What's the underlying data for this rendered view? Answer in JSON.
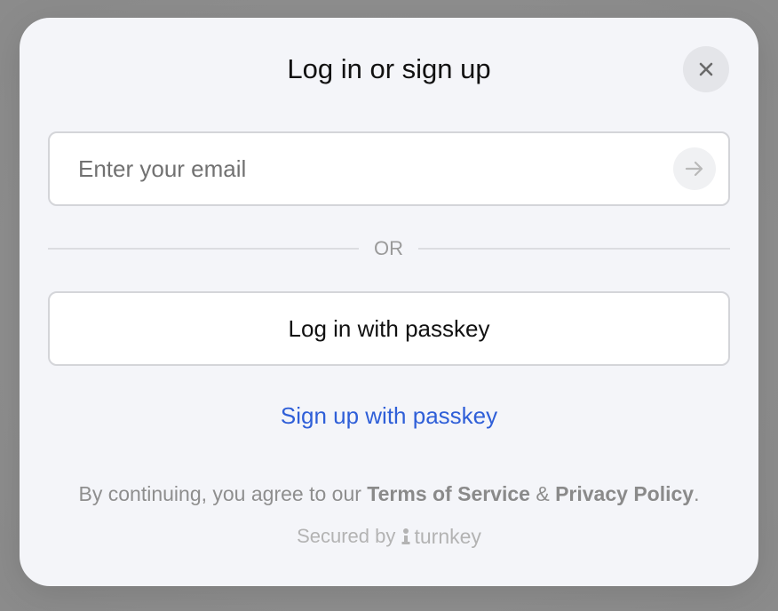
{
  "modal": {
    "title": "Log in or sign up",
    "close_icon": "close-icon",
    "email": {
      "placeholder": "Enter your email",
      "value": "",
      "submit_icon": "arrow-right-icon"
    },
    "divider_text": "OR",
    "passkey_login_label": "Log in with passkey",
    "passkey_signup_label": "Sign up with passkey",
    "terms": {
      "prefix": "By continuing, you agree to our ",
      "terms_label": "Terms of Service",
      "joiner": " & ",
      "privacy_label": "Privacy Policy",
      "suffix": "."
    },
    "secured": {
      "prefix": "Secured by",
      "brand": "turnkey",
      "brand_icon": "turnkey-logo-icon"
    }
  },
  "colors": {
    "backdrop": "#8f8f8f",
    "modal_bg": "#f4f5f9",
    "link_blue": "#2f5fd8",
    "muted_text": "#8e8e8e",
    "border": "#d4d5d9"
  }
}
